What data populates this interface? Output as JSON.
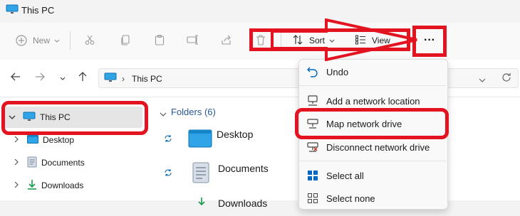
{
  "window": {
    "title": "This PC"
  },
  "toolbar": {
    "new_label": "New",
    "sort_label": "Sort",
    "view_label": "View",
    "more_label": "···"
  },
  "address": {
    "path": "This PC"
  },
  "nav": {
    "items": [
      {
        "label": "This PC",
        "icon": "computer-icon"
      },
      {
        "label": "Desktop",
        "icon": "desktop-folder-icon"
      },
      {
        "label": "Documents",
        "icon": "documents-folder-icon"
      },
      {
        "label": "Downloads",
        "icon": "downloads-folder-icon"
      }
    ]
  },
  "content": {
    "folders_header": "Folders (6)",
    "folders": [
      {
        "label": "Desktop",
        "icon": "desktop-folder-icon"
      },
      {
        "label": "Documents",
        "icon": "documents-folder-icon"
      },
      {
        "label": "Downloads",
        "icon": "downloads-folder-icon"
      }
    ]
  },
  "menu": {
    "items": [
      {
        "label": "Undo",
        "icon": "undo-icon"
      },
      {
        "label": "Add a network location",
        "icon": "network-location-icon"
      },
      {
        "label": "Map network drive",
        "icon": "map-drive-icon"
      },
      {
        "label": "Disconnect network drive",
        "icon": "disconnect-drive-icon"
      },
      {
        "label": "Select all",
        "icon": "select-all-icon"
      },
      {
        "label": "Select none",
        "icon": "select-none-icon"
      }
    ]
  },
  "colors": {
    "annotation_red": "#e3131f",
    "accent_blue": "#0067c0",
    "folder_blue": "#2fa4e7"
  }
}
